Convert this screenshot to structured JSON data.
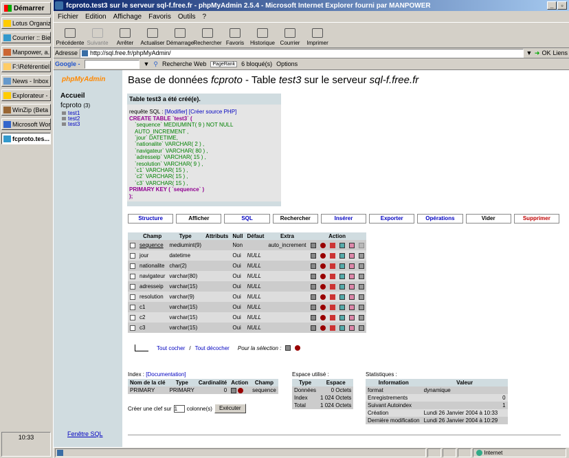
{
  "taskbar": {
    "start_label": "Démarrer",
    "buttons": [
      "Lotus Organiz...",
      "Courrier :: Bie...",
      "Manpower, a...",
      "F:\\Référentiel...",
      "News - Inbox ...",
      "Explorateur - ...",
      "WinZip (Beta ...",
      "Microsoft Wor...",
      "fcproto.tes..."
    ],
    "clock": "10:33"
  },
  "window": {
    "title": "fcproto.test3 sur le serveur sql-f.free.fr - phpMyAdmin 2.5.4 - Microsoft Internet Explorer fourni par MANPOWER",
    "menu": [
      "Fichier",
      "Edition",
      "Affichage",
      "Favoris",
      "Outils",
      "?"
    ],
    "toolbar": [
      "Précédente",
      "Suivante",
      "Arrêter",
      "Actualiser",
      "Démarrage",
      "Rechercher",
      "Favoris",
      "Historique",
      "Courrier",
      "Imprimer"
    ],
    "address_label": "Adresse",
    "address": "http://sql.free.fr/phpMyAdmin/",
    "go_label": "OK",
    "links_label": "Liens",
    "google_label": "Google -",
    "google_search": "Recherche Web",
    "pagerank": "PageRank",
    "blocked": "6 bloqué(s)",
    "options": "Options",
    "status_zone": "Internet"
  },
  "left": {
    "logo": "phpMyAdmin",
    "accueil": "Accueil",
    "db": "fcproto",
    "db_count": "(3)",
    "tables": [
      "test1",
      "test2",
      "test3"
    ],
    "fenetre": "Fenêtre SQL"
  },
  "main": {
    "title_pre": "Base de données ",
    "title_db": "fcproto",
    "title_mid": " - Table ",
    "title_tbl": "test3",
    "title_mid2": " sur le serveur ",
    "title_srv": "sql-f.free.fr",
    "created_msg": "Table test3 a été créé(e).",
    "sql_label": "requête SQL :",
    "modifier": "[Modifier]",
    "creer_php": "[Créer source PHP]",
    "sql_lines": [
      "CREATE TABLE `test3` (",
      "`sequence` MEDIUMINT( 9 ) NOT NULL AUTO_INCREMENT ,",
      "`jour` DATETIME,",
      "`nationalite` VARCHAR( 2 ) ,",
      "`navigateur` VARCHAR( 80 ) ,",
      "`adresseip` VARCHAR( 15 ) ,",
      "`resolution` VARCHAR( 9 ) ,",
      "`c1` VARCHAR( 15 ) ,",
      "`c2` VARCHAR( 15 ) ,",
      "`c3` VARCHAR( 15 ) ,",
      "PRIMARY KEY ( `sequence` )",
      ");"
    ],
    "tabs": [
      "Structure",
      "Afficher",
      "SQL",
      "Rechercher",
      "Insérer",
      "Exporter",
      "Opérations",
      "Vider",
      "Supprimer"
    ],
    "field_headers": [
      "Champ",
      "Type",
      "Attributs",
      "Null",
      "Défaut",
      "Extra",
      "Action"
    ],
    "fields": [
      {
        "name": "sequence",
        "type": "mediumint(9)",
        "attr": "",
        "null": "Non",
        "default": "",
        "extra": "auto_increment"
      },
      {
        "name": "jour",
        "type": "datetime",
        "attr": "",
        "null": "Oui",
        "default": "NULL",
        "extra": ""
      },
      {
        "name": "nationalite",
        "type": "char(2)",
        "attr": "",
        "null": "Oui",
        "default": "NULL",
        "extra": ""
      },
      {
        "name": "navigateur",
        "type": "varchar(80)",
        "attr": "",
        "null": "Oui",
        "default": "NULL",
        "extra": ""
      },
      {
        "name": "adresseip",
        "type": "varchar(15)",
        "attr": "",
        "null": "Oui",
        "default": "NULL",
        "extra": ""
      },
      {
        "name": "resolution",
        "type": "varchar(9)",
        "attr": "",
        "null": "Oui",
        "default": "NULL",
        "extra": ""
      },
      {
        "name": "c1",
        "type": "varchar(15)",
        "attr": "",
        "null": "Oui",
        "default": "NULL",
        "extra": ""
      },
      {
        "name": "c2",
        "type": "varchar(15)",
        "attr": "",
        "null": "Oui",
        "default": "NULL",
        "extra": ""
      },
      {
        "name": "c3",
        "type": "varchar(15)",
        "attr": "",
        "null": "Oui",
        "default": "NULL",
        "extra": ""
      }
    ],
    "tout_cocher": "Tout cocher",
    "sep": "/",
    "tout_decocher": "Tout décocher",
    "pour_selection": "Pour la sélection :",
    "index_label": "Index :",
    "documentation": "[Documentation]",
    "index_headers": [
      "Nom de la clé",
      "Type",
      "Cardinalité",
      "Action",
      "Champ"
    ],
    "index_row": {
      "name": "PRIMARY",
      "type": "PRIMARY",
      "card": "0",
      "field": "sequence"
    },
    "create_key_pre": "Créer une clef sur",
    "create_key_val": "1",
    "create_key_post": "colonne(s)",
    "execute": "Exécuter",
    "space_label": "Espace utilisé :",
    "space_headers": [
      "Type",
      "Espace"
    ],
    "space_rows": [
      [
        "Données",
        "0 Octets"
      ],
      [
        "Index",
        "1 024 Octets"
      ],
      [
        "Total",
        "1 024 Octets"
      ]
    ],
    "stats_label": "Statistiques :",
    "stats_headers": [
      "Information",
      "Valeur"
    ],
    "stats_rows": [
      [
        "format",
        "dynamique"
      ],
      [
        "Enregistrements",
        "0"
      ],
      [
        "Suivant Autoindex",
        "1"
      ],
      [
        "Création",
        "Lundi 26 Janvier 2004 à 10:33"
      ],
      [
        "Dernière modification",
        "Lundi 26 Janvier 2004 à 10:29"
      ]
    ]
  }
}
